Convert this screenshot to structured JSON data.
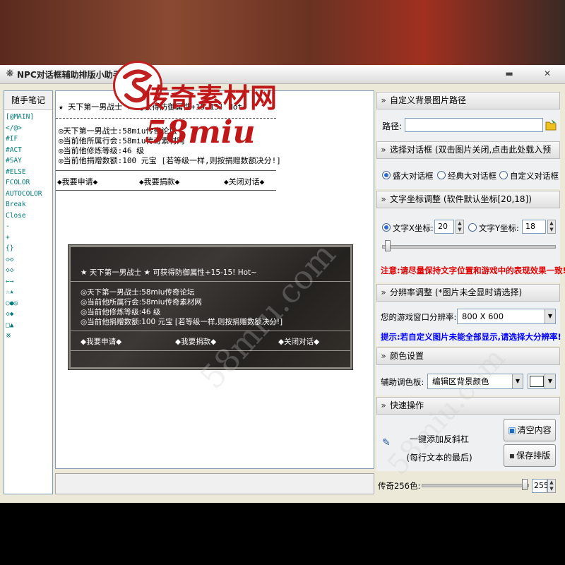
{
  "window": {
    "title": "NPC对话框辅助排版小助手",
    "minimize_glyph": "▬",
    "close_glyph": "✕"
  },
  "watermark": {
    "brand_cn": "传奇素材网",
    "brand_en": "58miu",
    "diagonal": "58miu.com"
  },
  "notes": {
    "title": "随手笔记",
    "items": [
      "[@MAIN]",
      "</@>",
      "#IF",
      "#ACT",
      "#SAY",
      "#ELSE",
      "FCOLOR",
      "AUTOCOLOR",
      "Break",
      "Close",
      "-",
      "+",
      "{}",
      "◇◇",
      "◇◇",
      "←→",
      "☆★",
      "○●◎",
      "◇◆",
      "□▲",
      "※"
    ]
  },
  "editor": {
    "line1": "★ 天下第一男战士 ★    可获得防御属性+15-15!  Hot~",
    "line2": "◎天下第一男战士:58miu传奇论坛",
    "line3": "◎当前他所属行会:58miu传奇素材网",
    "line4": "◎当前他修炼等级:46 级",
    "line5": "◎当前他捐赠数额:100 元宝 [若等级一样,则按捐赠数额决分!]",
    "link1": "◆我要申请◆",
    "link2": "◆我要捐款◆",
    "link3": "◆关闭对话◆"
  },
  "preview": {
    "line1": "★ 天下第一男战士 ★     可获得防御属性+15-15!  Hot~",
    "line2": "◎天下第一男战士:58miu传奇论坛",
    "line3": "◎当前他所属行会:58miu传奇素材网",
    "line4": "◎当前他修炼等级:46 级",
    "line5": "◎当前他捐赠数额:100 元宝 [若等级一样,则按捐赠数额决分!]",
    "link1": "◆我要申请◆",
    "link2": "◆我要捐款◆",
    "link3": "◆关闭对话◆"
  },
  "bg_path": {
    "heading": "自定义背景图片路径",
    "label": "路径:",
    "value": ""
  },
  "dialog_select": {
    "heading": "选择对话框 (双击图片关闭,点击此处载入预览)",
    "options": [
      "盛大对话框",
      "经典大对话框",
      "自定义对话框"
    ],
    "selected": "盛大对话框"
  },
  "coords": {
    "heading": "文字坐标调整 (软件默认坐标[20,18])",
    "x_label": "文字X坐标:",
    "x_value": "20",
    "y_label": "文字Y坐标:",
    "y_value": "18",
    "note": "注意:请尽量保持文字位置和游戏中的表现效果一致!"
  },
  "resolution": {
    "heading": "分辨率调整 (*图片未全显时请选择)",
    "label": "您的游戏窗口分辨率:",
    "value": "800 X 600",
    "tip": "提示:若自定义图片未能全部显示,请选择大分辨率!"
  },
  "color": {
    "heading": "颜色设置",
    "label": "辅助调色板:",
    "value": "编辑区背景颜色"
  },
  "quick": {
    "heading": "快速操作",
    "add_line1": "一键添加反斜杠",
    "add_line2": "(每行文本的最后)",
    "clear": "清空内容",
    "save": "保存排版"
  },
  "transparency": {
    "label": "传奇256色:",
    "value": "255",
    "level": 1.0
  },
  "colors": {
    "required_red": "#e00000",
    "tip_blue": "#0000ff"
  }
}
